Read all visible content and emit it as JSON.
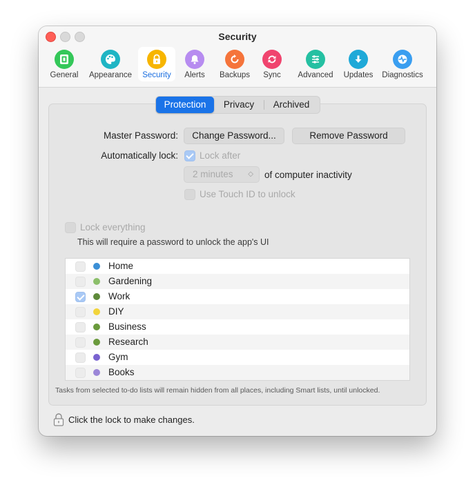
{
  "window": {
    "title": "Security"
  },
  "toolbar": {
    "items": [
      {
        "label": "General",
        "icon": "general-icon",
        "color": "#34c759"
      },
      {
        "label": "Appearance",
        "icon": "palette-icon",
        "color": "#1fb5c4"
      },
      {
        "label": "Security",
        "icon": "lock-icon",
        "color": "#f7b500",
        "active": true
      },
      {
        "label": "Alerts",
        "icon": "bell-icon",
        "color": "#b78cf0"
      },
      {
        "label": "Backups",
        "icon": "backup-icon",
        "color": "#f5743b"
      },
      {
        "label": "Sync",
        "icon": "sync-icon",
        "color": "#f0446e"
      },
      {
        "label": "Advanced",
        "icon": "sliders-icon",
        "color": "#25c0a2"
      },
      {
        "label": "Updates",
        "icon": "download-icon",
        "color": "#1fa9d8"
      },
      {
        "label": "Diagnostics",
        "icon": "diagnostics-icon",
        "color": "#3a9ef0"
      }
    ]
  },
  "tabs": {
    "items": [
      {
        "label": "Protection",
        "active": true
      },
      {
        "label": "Privacy"
      },
      {
        "label": "Archived"
      }
    ]
  },
  "protection": {
    "master_password_label": "Master Password:",
    "change_password_button": "Change Password...",
    "remove_password_button": "Remove Password",
    "auto_lock_label": "Automatically lock:",
    "lock_after_label": "Lock after",
    "lock_after_checked": true,
    "lock_interval": "2 minutes",
    "inactivity_label": "of computer inactivity",
    "touch_id_label": "Use Touch ID to unlock",
    "touch_id_checked": false,
    "lock_everything_label": "Lock everything",
    "lock_everything_checked": false,
    "lock_everything_note": "This will require a password to unlock the app's UI"
  },
  "lists": [
    {
      "name": "Home",
      "color": "#3b8fd6",
      "checked": false
    },
    {
      "name": "Gardening",
      "color": "#8cbf6a",
      "checked": false
    },
    {
      "name": "Work",
      "color": "#5e8a3a",
      "checked": true
    },
    {
      "name": "DIY",
      "color": "#f2d43b",
      "checked": false
    },
    {
      "name": "Business",
      "color": "#6a9a3c",
      "checked": false
    },
    {
      "name": "Research",
      "color": "#6a9a3c",
      "checked": false
    },
    {
      "name": "Gym",
      "color": "#7a63d0",
      "checked": false
    },
    {
      "name": "Books",
      "color": "#9b86d8",
      "checked": false
    }
  ],
  "footnote": "Tasks from selected to-do lists will remain hidden from all places, including Smart lists, until unlocked.",
  "lock_status": {
    "label": "Click the lock to make changes.",
    "icon": "padlock-icon"
  }
}
